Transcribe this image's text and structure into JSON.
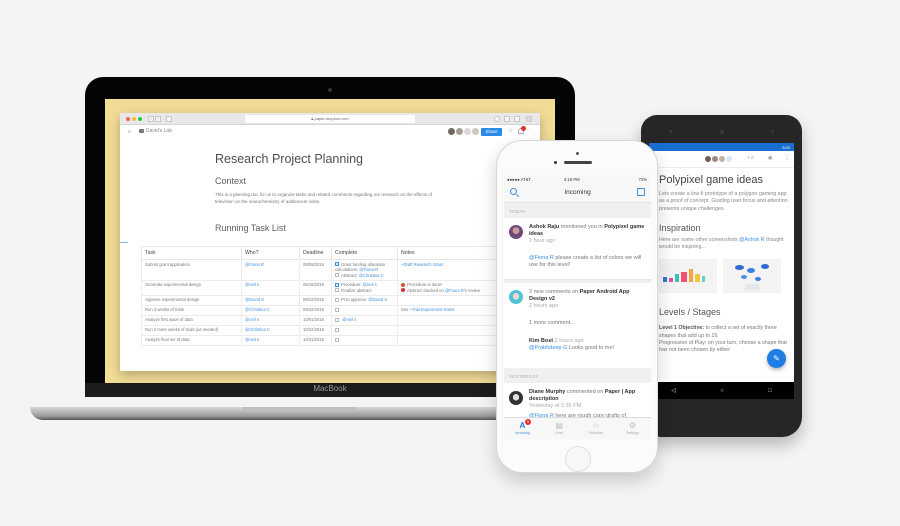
{
  "laptop": {
    "brand": "MacBook",
    "browser": {
      "url": "paper.dropbox.com",
      "folder": "David's Lab",
      "share_label": "Share"
    },
    "doc": {
      "title": "Research Project Planning",
      "context_heading": "Context",
      "context_text": "This is a planning doc for us to organize tasks and related comments regarding our research on the effects of television on the neurochemistry of adolescent voles.",
      "tasks_heading": "Running Task List",
      "table": {
        "headers": [
          "Task",
          "Who?",
          "Deadline",
          "Complete",
          "Notes"
        ],
        "rows": [
          {
            "task": "Submit grant application",
            "who": "@Fiona R",
            "deadline": "08/05/2016",
            "complete": [
              {
                "checked": true,
                "text": "Grant funding allocation calculations:",
                "mention": "@Fiona R"
              },
              {
                "checked": false,
                "text": "Abstract:",
                "mention": "@Christina C"
              }
            ],
            "notes": [
              {
                "prefix": "",
                "link": "~Draft Research Grant",
                "suffix": ""
              }
            ]
          },
          {
            "task": "Generate experimental design",
            "who": "@neil s",
            "deadline": "08/15/2016",
            "complete": [
              {
                "checked": true,
                "text": "Procedure:",
                "mention": "@neil s"
              },
              {
                "checked": false,
                "text": "Finalize abstract",
                "mention": ""
              }
            ],
            "notes": [
              {
                "prefix": "Procedure is done!",
                "link": "",
                "suffix": "",
                "emoji": "#d4502a"
              },
              {
                "prefix": "Abstract blocked on ",
                "link": "@Fiona R",
                "suffix": "'s review",
                "emoji": "#e0312f"
              }
            ]
          },
          {
            "task": "Approve experimental design",
            "who": "@David S",
            "deadline": "08/22/2016",
            "complete": [
              {
                "checked": false,
                "text": "PI to approve:",
                "mention": "@David S"
              }
            ],
            "notes": []
          },
          {
            "task": "Run 3 weeks of trials",
            "who": "@Christina C",
            "deadline": "09/22/2016",
            "complete": [
              {
                "checked": false,
                "text": "",
                "mention": ""
              }
            ],
            "notes": [
              {
                "prefix": "See ",
                "link": "~Trial Experiment Notes",
                "suffix": ""
              }
            ]
          },
          {
            "task": "Analyze first wave of data",
            "who": "@neil s",
            "deadline": "10/01/2016",
            "complete": [
              {
                "checked": false,
                "text": "",
                "mention": "@neil s"
              }
            ],
            "notes": []
          },
          {
            "task": "Run 2 more weeks of trials (as needed)",
            "who": "@Christina C",
            "deadline": "10/22/2016",
            "complete": [
              {
                "checked": false,
                "text": "",
                "mention": ""
              }
            ],
            "notes": []
          },
          {
            "task": "Analyze final set of data",
            "who": "@neil s",
            "deadline": "10/31/2016",
            "complete": [
              {
                "checked": false,
                "text": "",
                "mention": ""
              }
            ],
            "notes": []
          }
        ]
      }
    }
  },
  "iphone": {
    "status": {
      "carrier": "●●●●● AT&T",
      "time": "4:16 PM",
      "battery": "72%"
    },
    "nav_title": "Incoming",
    "sections": {
      "today": "TODAY",
      "yesterday": "YESTERDAY"
    },
    "feed": [
      {
        "actor": "Ashok Raju",
        "action": " mentioned you in ",
        "target": "Polypixel game ideas",
        "time": "1 hour ago",
        "mention": "@Fiona R",
        "body": " please create a list of colors we will use for this level!"
      },
      {
        "actor": "",
        "action": "2 new comments on ",
        "target": "Paper Android App Design v2",
        "time": "2 hours ago",
        "more": "1 more comment...",
        "reply_author": "Kim Bost",
        "reply_time": "2 hours ago",
        "reply_mention": "@Prabhdeep G",
        "reply_body": " Looks good to me!"
      },
      {
        "actor": "Diane Murphy",
        "action": " commented on ",
        "target": "Paper | App description",
        "time": "Yesterday at 5:35 PM",
        "mention": "@Fiona R",
        "body": " here are rough copy drafts of"
      }
    ],
    "tabs": [
      {
        "label": "Incoming",
        "icon": "A",
        "badge": "5",
        "active": true
      },
      {
        "label": "Docs",
        "icon": "▤",
        "active": false
      },
      {
        "label": "Favorites",
        "icon": "☆",
        "active": false
      },
      {
        "label": "Settings",
        "icon": "⚙",
        "active": false
      }
    ]
  },
  "android": {
    "status_time": "3:00",
    "doc_title": "Polypixel game ideas",
    "intro": "Lets create a low-fi prototype of a polygon gaming app as a proof of concept. Guiding user focus and attention presents unique challenges.",
    "inspiration_heading": "Inspiration",
    "inspiration_text_pre": "Here are some other screenshots ",
    "inspiration_mention": "@Ashok R",
    "inspiration_text_post": " thought would be inspiring...",
    "levels_heading": "Levels / Stages",
    "level1_label": "Level 1 Objective:",
    "level1_text": " to collect a set of exactly three shapes that add up to 15.",
    "progression_text": "Progression of Play: on your turn, choose a shape that has not been chosen by either",
    "fab_icon": "✎",
    "nav": {
      "back": "◁",
      "home": "○",
      "recents": "□"
    }
  }
}
